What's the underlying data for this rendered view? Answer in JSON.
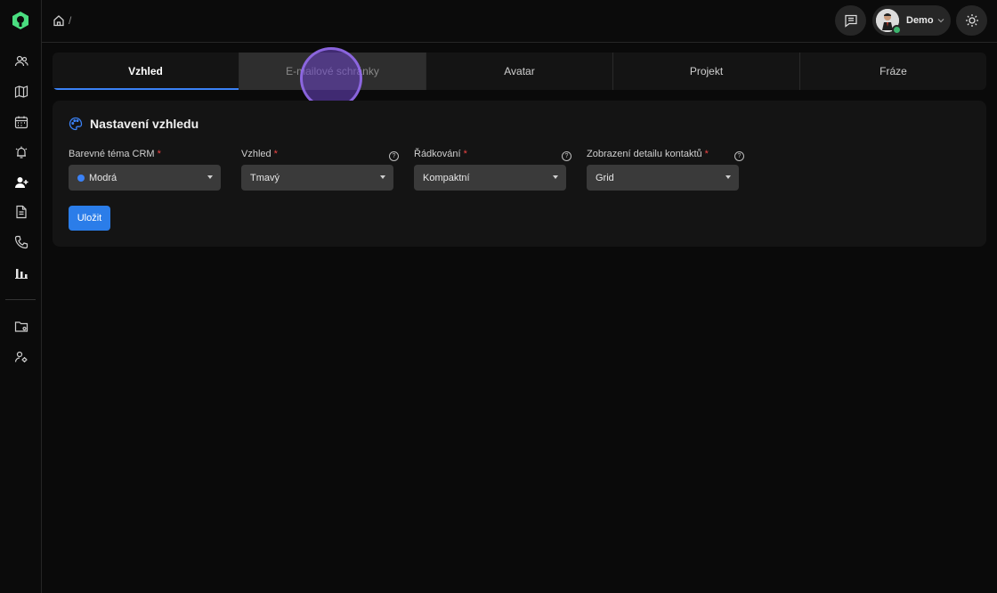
{
  "colors": {
    "accent": "#3b82f6",
    "brand": "#4ade80",
    "required": "#ef4444",
    "online": "#3cb46e"
  },
  "sidebar": {
    "logo": "crm-logo-icon",
    "items": [
      {
        "icon": "users-icon"
      },
      {
        "icon": "map-icon"
      },
      {
        "icon": "calendar-icon"
      },
      {
        "icon": "bell-alarm-icon"
      },
      {
        "icon": "user-add-icon"
      },
      {
        "icon": "document-icon"
      },
      {
        "icon": "phone-icon"
      },
      {
        "icon": "bar-chart-icon"
      },
      {
        "icon": "folder-settings-icon"
      },
      {
        "icon": "user-settings-icon"
      }
    ]
  },
  "header": {
    "breadcrumb_sep": "/",
    "user": {
      "name": "Demo"
    }
  },
  "tabs": [
    {
      "label": "Vzhled",
      "active": true
    },
    {
      "label": "E-mailové schránky",
      "active": false
    },
    {
      "label": "Avatar",
      "active": false
    },
    {
      "label": "Projekt",
      "active": false
    },
    {
      "label": "Fráze",
      "active": false
    }
  ],
  "card": {
    "title": "Nastavení vzhledu",
    "fields": [
      {
        "label": "Barevné téma CRM",
        "required": "*",
        "value": "Modrá"
      },
      {
        "label": "Vzhled",
        "required": "*",
        "value": "Tmavý",
        "help": "?"
      },
      {
        "label": "Řádkování",
        "required": "*",
        "value": "Kompaktní",
        "help": "?"
      },
      {
        "label": "Zobrazení detailu kontaktů",
        "required": "*",
        "value": "Grid",
        "help": "?"
      }
    ],
    "save_label": "Uložit"
  }
}
